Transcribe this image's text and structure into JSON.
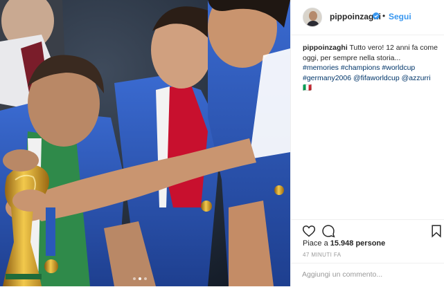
{
  "header": {
    "username": "pippoinzaghi",
    "separator": "•",
    "follow_label": "Segui"
  },
  "caption": {
    "username": "pippoinzaghi",
    "text": "Tutto vero! 12 anni fa come oggi, per sempre nella storia... ",
    "hashtags": [
      "#memories",
      "#champions",
      "#worldcup",
      "#germany2006"
    ],
    "mentions": [
      "@fifaworldcup",
      "@azzurri"
    ],
    "trailing": "🇮🇹"
  },
  "likes": {
    "prefix": "Piace a ",
    "count": "15.948",
    "suffix": " persone"
  },
  "time_ago": "47 MINUTI FA",
  "comment": {
    "placeholder": "Aggiungi un commento..."
  },
  "carousel": {
    "total": 3,
    "active_index": 1
  },
  "colors": {
    "link": "#3897f0",
    "hashtag": "#003569",
    "text": "#262626",
    "muted": "#999999",
    "border": "#efefef",
    "italy_blue": "#2a58b8"
  },
  "icons": {
    "like": "heart-outline-icon",
    "comment": "comment-bubble-icon",
    "save": "bookmark-outline-icon",
    "verified": "verified-badge-icon"
  }
}
